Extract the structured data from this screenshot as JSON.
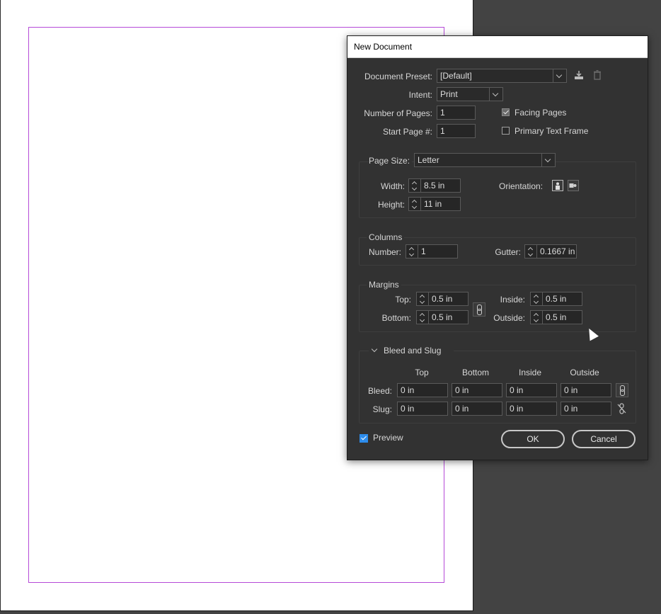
{
  "dialog": {
    "title": "New Document",
    "document_preset": {
      "label": "Document Preset:",
      "value": "[Default]"
    },
    "intent": {
      "label": "Intent:",
      "value": "Print"
    },
    "num_pages": {
      "label": "Number of Pages:",
      "value": "1"
    },
    "start_page": {
      "label": "Start Page #:",
      "value": "1"
    },
    "facing_pages": {
      "label": "Facing Pages",
      "checked": true
    },
    "primary_text_frame": {
      "label": "Primary Text Frame",
      "checked": false
    },
    "page_size": {
      "label": "Page Size:",
      "value": "Letter"
    },
    "width": {
      "label": "Width:",
      "value": "8.5 in"
    },
    "height": {
      "label": "Height:",
      "value": "11 in"
    },
    "orientation": {
      "label": "Orientation:"
    },
    "columns": {
      "title": "Columns",
      "number_label": "Number:",
      "number_value": "1",
      "gutter_label": "Gutter:",
      "gutter_value": "0.1667 in"
    },
    "margins": {
      "title": "Margins",
      "top_label": "Top:",
      "top_value": "0.5 in",
      "bottom_label": "Bottom:",
      "bottom_value": "0.5 in",
      "inside_label": "Inside:",
      "inside_value": "0.5 in",
      "outside_label": "Outside:",
      "outside_value": "0.5 in"
    },
    "bleed_slug": {
      "title": "Bleed and Slug",
      "headers": [
        "Top",
        "Bottom",
        "Inside",
        "Outside"
      ],
      "bleed_label": "Bleed:",
      "bleed_values": [
        "0 in",
        "0 in",
        "0 in",
        "0 in"
      ],
      "slug_label": "Slug:",
      "slug_values": [
        "0 in",
        "0 in",
        "0 in",
        "0 in"
      ]
    },
    "preview": {
      "label": "Preview",
      "checked": true
    },
    "ok_label": "OK",
    "cancel_label": "Cancel"
  },
  "colors": {
    "dialog_bg": "#323232",
    "margin_guide": "#b64ad8",
    "pasteboard": "#434343",
    "preview_check": "#2d8ceb"
  }
}
